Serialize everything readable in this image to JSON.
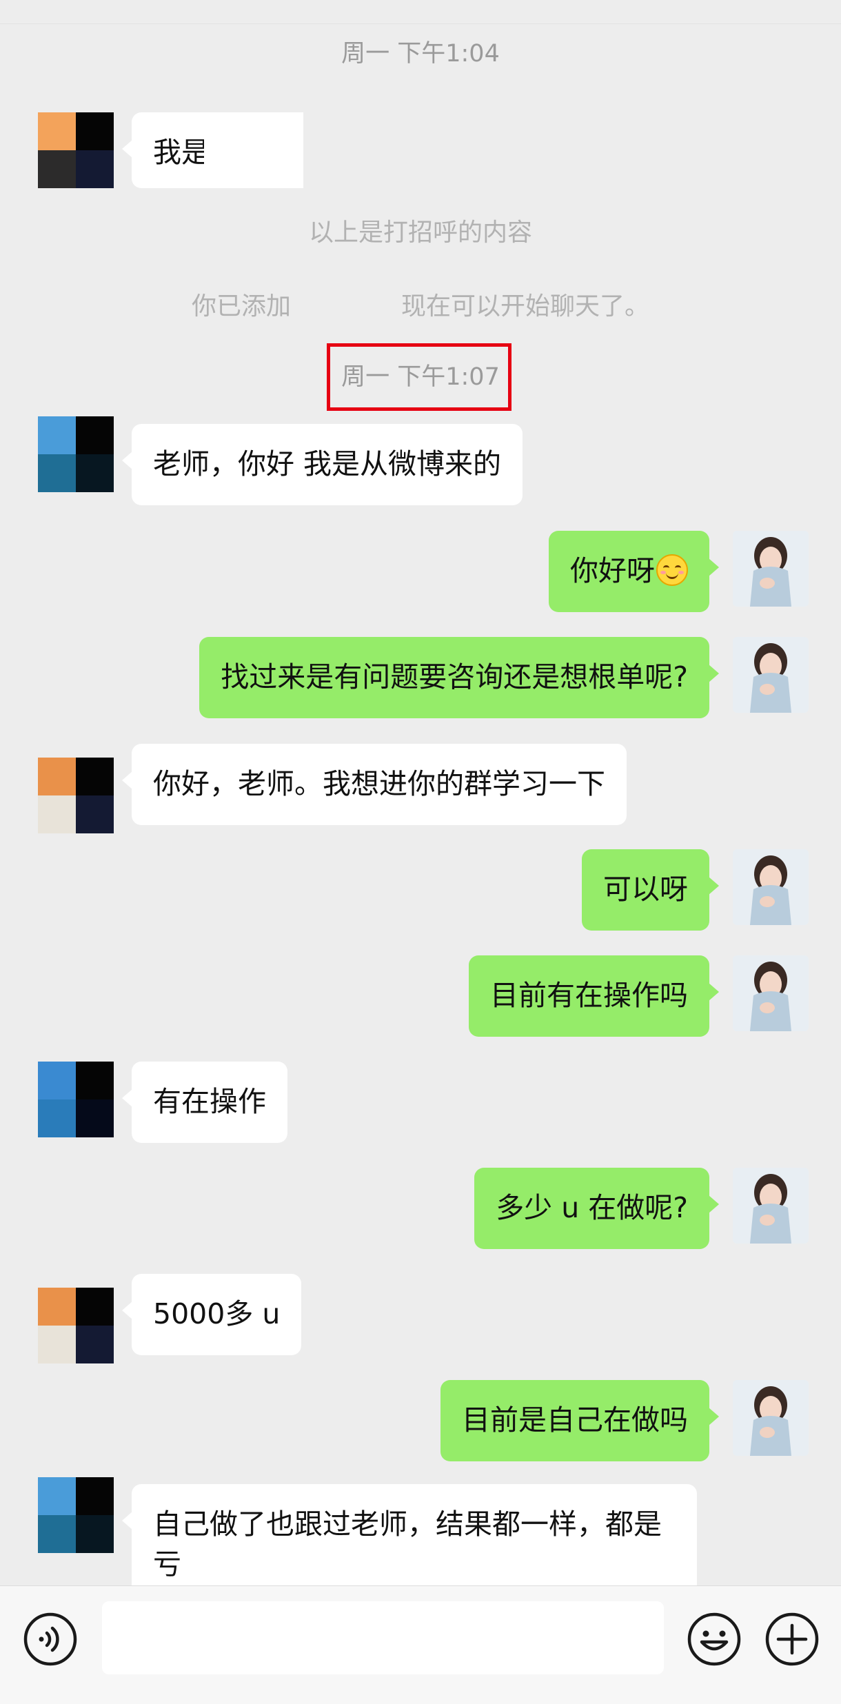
{
  "timestamps": [
    "周一 下午1:04",
    "周一 下午1:07"
  ],
  "system_messages": {
    "greeting_note": "以上是打招呼的内容",
    "added_prefix": "你已添加",
    "added_suffix": "现在可以开始聊天了。"
  },
  "messages": [
    {
      "side": "in",
      "text": "我是",
      "avatar": "orange-black"
    },
    {
      "side": "in",
      "text": "老师，你好 我是从微博来的",
      "avatar": "blue-black"
    },
    {
      "side": "out",
      "text": "你好呀",
      "emoji": "smiling-face"
    },
    {
      "side": "out",
      "text": "找过来是有问题要咨询还是想根单呢?"
    },
    {
      "side": "in",
      "text": "你好，老师。我想进你的群学习一下",
      "avatar": "orange-black"
    },
    {
      "side": "out",
      "text": "可以呀"
    },
    {
      "side": "out",
      "text": "目前有在操作吗"
    },
    {
      "side": "in",
      "text": "有在操作",
      "avatar": "blue-black"
    },
    {
      "side": "out",
      "text": "多少 u 在做呢?"
    },
    {
      "side": "in",
      "text": "5000多 u",
      "avatar": "orange-black"
    },
    {
      "side": "out",
      "text": "目前是自己在做吗"
    },
    {
      "side": "in",
      "text": "自己做了也跟过老师，结果都一样，都是亏",
      "avatar": "blue-black"
    }
  ],
  "colors": {
    "background": "#ededed",
    "outgoing_bubble": "#95ec69",
    "incoming_bubble": "#ffffff",
    "highlight_box": "#e60012"
  },
  "input_bar": {
    "voice_icon": "voice-icon",
    "emoji_icon": "emoji-icon",
    "add_icon": "plus-icon",
    "value": ""
  }
}
